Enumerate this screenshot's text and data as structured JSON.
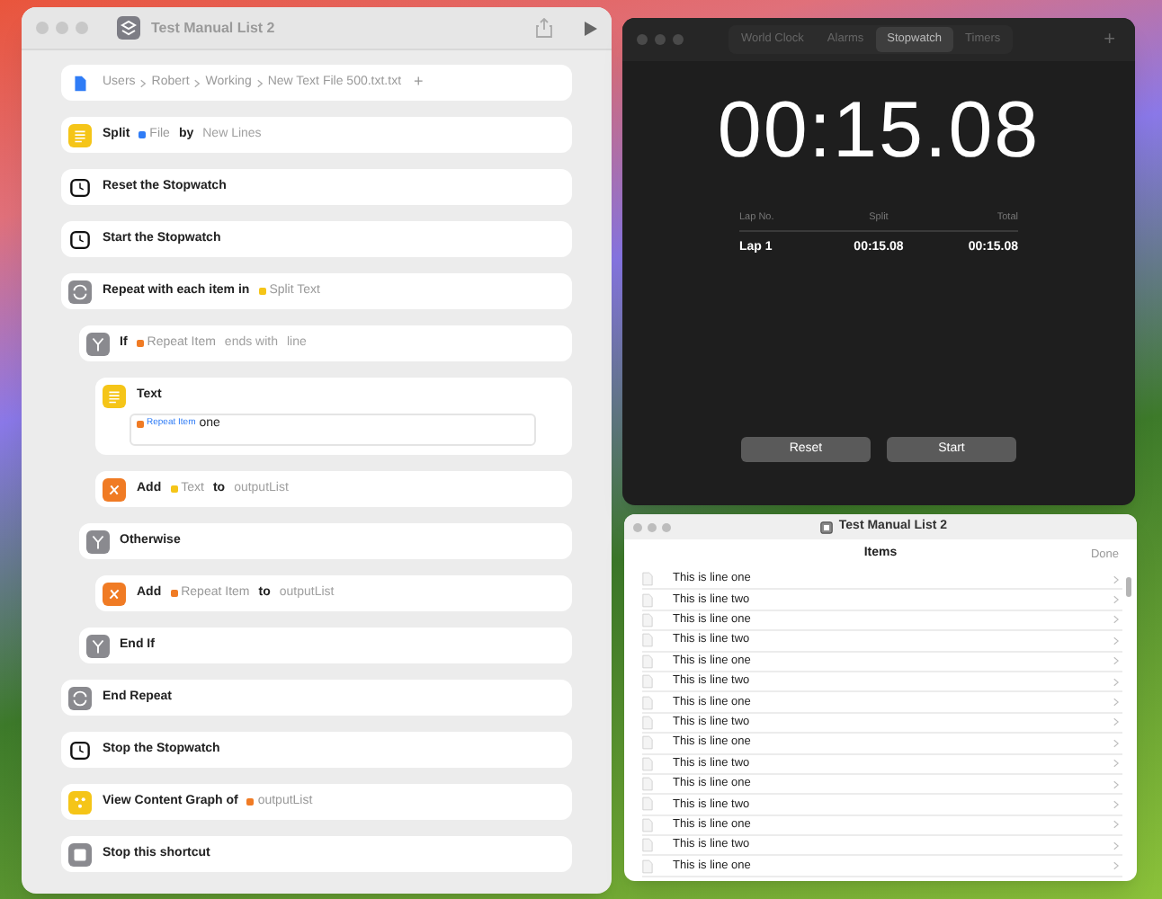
{
  "shortcut_window": {
    "title": "Test Manual List 2",
    "actions": [
      {
        "kind": "file",
        "parts": [
          {
            "kind": "path",
            "text": "Users"
          },
          {
            "kind": "path",
            "text": "Robert"
          },
          {
            "kind": "path",
            "text": "Working"
          },
          {
            "kind": "path",
            "text": "New Text File 500.txt.txt"
          },
          {
            "kind": "add",
            "text": "+"
          }
        ]
      },
      {
        "kind": "text",
        "parts": [
          {
            "kind": "label",
            "text": "Split"
          },
          {
            "kind": "token",
            "text": "File",
            "color": "#2f7cf6"
          },
          {
            "kind": "label",
            "text": "by"
          },
          {
            "kind": "param",
            "text": "New Lines"
          }
        ]
      },
      {
        "kind": "stopwatch",
        "parts": [
          {
            "kind": "label",
            "text": "Reset the Stopwatch"
          }
        ]
      },
      {
        "kind": "stopwatch",
        "parts": [
          {
            "kind": "label",
            "text": "Start the Stopwatch"
          }
        ]
      },
      {
        "kind": "repeat",
        "parts": [
          {
            "kind": "label",
            "text": "Repeat with each item in"
          },
          {
            "kind": "token",
            "text": "Split Text",
            "color": "#f5c518"
          }
        ],
        "children": [
          {
            "kind": "if",
            "parts": [
              {
                "kind": "label",
                "text": "If"
              },
              {
                "kind": "token",
                "text": "Repeat Item",
                "color": "#f07b24"
              },
              {
                "kind": "param",
                "text": "ends with"
              },
              {
                "kind": "param",
                "text": "line"
              }
            ],
            "children": [
              {
                "kind": "text",
                "parts": [
                  {
                    "kind": "label",
                    "text": "Text"
                  }
                ],
                "body": [
                  {
                    "kind": "token",
                    "text": "Repeat Item",
                    "color": "#f07b24"
                  },
                  {
                    "kind": "plain",
                    "text": "one"
                  }
                ]
              },
              {
                "kind": "variable",
                "parts": [
                  {
                    "kind": "label",
                    "text": "Add"
                  },
                  {
                    "kind": "token",
                    "text": "Text",
                    "color": "#f5c518"
                  },
                  {
                    "kind": "label",
                    "text": "to"
                  },
                  {
                    "kind": "param",
                    "text": "outputList"
                  }
                ]
              }
            ]
          },
          {
            "kind": "if",
            "parts": [
              {
                "kind": "label",
                "text": "Otherwise"
              }
            ],
            "children": [
              {
                "kind": "variable",
                "parts": [
                  {
                    "kind": "label",
                    "text": "Add"
                  },
                  {
                    "kind": "token",
                    "text": "Repeat Item",
                    "color": "#f07b24"
                  },
                  {
                    "kind": "label",
                    "text": "to"
                  },
                  {
                    "kind": "param",
                    "text": "outputList"
                  }
                ]
              }
            ]
          },
          {
            "kind": "if",
            "parts": [
              {
                "kind": "label",
                "text": "End If"
              }
            ]
          }
        ]
      },
      {
        "kind": "repeat",
        "parts": [
          {
            "kind": "label",
            "text": "End Repeat"
          }
        ]
      },
      {
        "kind": "stopwatch",
        "parts": [
          {
            "kind": "label",
            "text": "Stop the Stopwatch"
          }
        ]
      },
      {
        "kind": "graph",
        "parts": [
          {
            "kind": "label",
            "text": "View Content Graph of"
          },
          {
            "kind": "token",
            "text": "outputList",
            "color": "#f07b24"
          }
        ]
      },
      {
        "kind": "stop",
        "parts": [
          {
            "kind": "label",
            "text": "Stop this shortcut"
          }
        ]
      }
    ]
  },
  "clock_window": {
    "tabs": [
      {
        "label": "World Clock",
        "selected": false
      },
      {
        "label": "Alarms",
        "selected": false
      },
      {
        "label": "Stopwatch",
        "selected": true
      },
      {
        "label": "Timers",
        "selected": false
      }
    ],
    "add": "+",
    "time": "00:15.08",
    "lap_columns": [
      "Lap No.",
      "Split",
      "Total"
    ],
    "laps": [
      [
        "Lap 1",
        "00:15.08",
        "00:15.08"
      ]
    ],
    "buttons": [
      "Reset",
      "Start"
    ]
  },
  "list_window": {
    "title": "Test Manual List 2",
    "header": "Items",
    "done": "Done",
    "rows": [
      "This is line one",
      "This is line two",
      "This is line one",
      "This is line two",
      "This is line one",
      "This is line two",
      "This is line one",
      "This is line two",
      "This is line one",
      "This is line two",
      "This is line one",
      "This is line two",
      "This is line one",
      "This is line two",
      "This is line one"
    ]
  }
}
